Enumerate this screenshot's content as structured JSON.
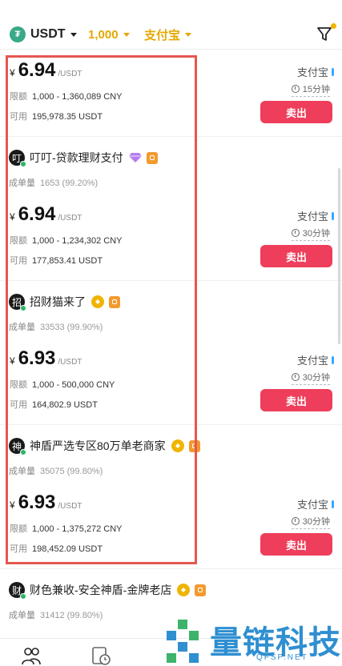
{
  "filters": {
    "coin": "USDT",
    "coin_icon": "tether-icon",
    "amount": "1,000",
    "payment": "支付宝",
    "accent": "#e3a800"
  },
  "labels": {
    "limit": "限额",
    "available": "可用",
    "completion": "成单量",
    "yen": "¥",
    "unit": "/USDT",
    "sell": "卖出"
  },
  "offers": [
    {
      "merchant": null,
      "price": "6.94",
      "limit": "1,000 - 1,360,089 CNY",
      "available": "195,978.35 USDT",
      "method": "支付宝",
      "time": "15分钟"
    },
    {
      "merchant": {
        "initial": "叮",
        "name": "叮叮-贷款理财支付",
        "orders": "1653 (99.20%)",
        "badges": [
          "diamond-icon",
          "shield-icon"
        ]
      },
      "price": "6.94",
      "limit": "1,000 - 1,234,302 CNY",
      "available": "177,853.41 USDT",
      "method": "支付宝",
      "time": "30分钟"
    },
    {
      "merchant": {
        "initial": "招",
        "name": "招财猫来了",
        "orders": "33533 (99.90%)",
        "badges": [
          "coin-icon",
          "shield-icon"
        ]
      },
      "price": "6.93",
      "limit": "1,000 - 500,000 CNY",
      "available": "164,802.9 USDT",
      "method": "支付宝",
      "time": "30分钟"
    },
    {
      "merchant": {
        "initial": "神",
        "name": "神盾严选专区80万单老商家",
        "orders": "35075 (99.80%)",
        "badges": [
          "coin-icon",
          "shield-icon"
        ]
      },
      "price": "6.93",
      "limit": "1,000 - 1,375,272 CNY",
      "available": "198,452.09 USDT",
      "method": "支付宝",
      "time": "30分钟"
    },
    {
      "merchant": {
        "initial": "财",
        "name": "财色兼收-安全神盾-金牌老店",
        "orders": "31412 (99.80%)",
        "badges": [
          "coin-icon",
          "shield-icon"
        ]
      }
    }
  ],
  "watermark": {
    "text": "量链科技",
    "sub": "QFSP.NET"
  },
  "colors": {
    "sell_button": "#ee3e5b",
    "highlight": "#e4574f",
    "brand": "#2f8fd1"
  }
}
